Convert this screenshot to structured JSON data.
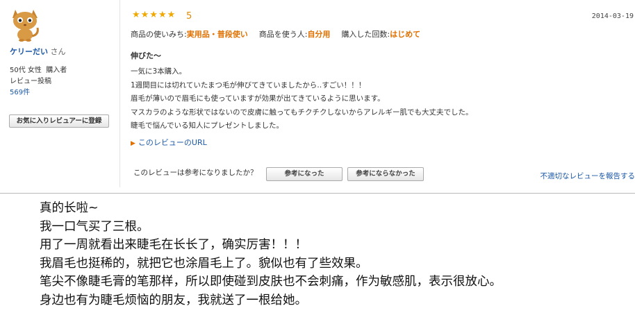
{
  "reviewer": {
    "name": "ケリーだい",
    "honorific": "さん",
    "age_gender": "50代 女性",
    "status": "購入者",
    "review_label": "レビュー投稿",
    "review_count": "569件",
    "favorite_button": "お気に入りレビュアーに登録",
    "avatar_icon": "cat-avatar-icon"
  },
  "review": {
    "stars": "★★★★★",
    "rating": "5",
    "rating_value": 5,
    "date": "2014-03-19",
    "usage_label": "商品の使いみち:",
    "usage_value": "実用品・普段使い",
    "user_label": "商品を使う人:",
    "user_value": "自分用",
    "purchase_label": "購入した回数:",
    "purchase_value": "はじめて",
    "title": "伸びた～",
    "lines": [
      "一気に3本購入。",
      "1週間目には切れていたまつ毛が伸びてきていましたから‥すごい！！！",
      "眉毛が薄いので眉毛にも使っていますが効果が出てきているように思います。",
      "マスカラのような形状ではないので皮膚に触ってもチクチクしないからアレルギー肌でも大丈夫でした。",
      "睫毛で悩んでいる知人にプレゼントしました。"
    ],
    "url_link": "このレビューのURL",
    "helpful_question": "このレビューは参考になりましたか？",
    "helpful_yes": "参考になった",
    "helpful_no": "参考にならなかった",
    "report_link": "不適切なレビューを報告する"
  },
  "translation": {
    "lines": [
      "真的长啦~",
      "我一口气买了三根。",
      "用了一周就看出来睫毛在长长了，确实厉害！！！",
      "我眉毛也挺稀的，就把它也涂眉毛上了。貌似也有了些效果。",
      "笔尖不像睫毛膏的笔那样，所以即使碰到皮肤也不会刺痛，作为敏感肌，表示很放心。",
      "身边也有为睫毛烦恼的朋友，我就送了一根给她。"
    ]
  },
  "colors": {
    "star": "#f0a800",
    "accent_orange": "#e07000",
    "link_blue": "#1a57a6"
  }
}
